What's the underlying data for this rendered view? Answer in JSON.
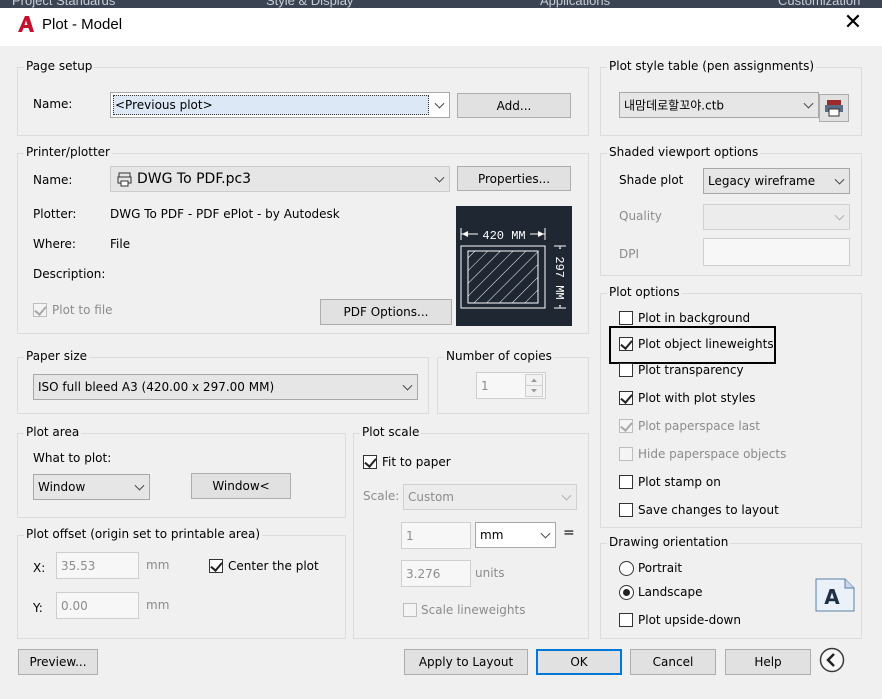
{
  "menubar": {
    "items": [
      "Project Standards",
      "Style & Display",
      "Applications",
      "Customization"
    ]
  },
  "window": {
    "title": "Plot - Model",
    "close_glyph": "✕"
  },
  "page_setup": {
    "group_label": "Page setup",
    "name_label": "Name:",
    "name_value": "<Previous plot>",
    "add_button": "Add..."
  },
  "printer": {
    "group_label": "Printer/plotter",
    "name_label": "Name:",
    "name_value": "DWG To PDF.pc3",
    "properties_button": "Properties...",
    "plotter_label": "Plotter:",
    "plotter_value": "DWG To PDF - PDF ePlot - by Autodesk",
    "where_label": "Where:",
    "where_value": "File",
    "description_label": "Description:",
    "plot_to_file_label": "Plot to file",
    "pdf_options_button": "PDF Options...",
    "preview": {
      "width_label": "420 MM",
      "height_label": "297 MM"
    }
  },
  "paper_size": {
    "group_label": "Paper size",
    "value": "ISO full bleed A3 (420.00 x 297.00 MM)"
  },
  "copies": {
    "group_label": "Number of copies",
    "value": "1"
  },
  "plot_area": {
    "group_label": "Plot area",
    "what_label": "What to plot:",
    "what_value": "Window",
    "window_button": "Window<"
  },
  "plot_offset": {
    "group_label": "Plot offset (origin set to printable area)",
    "x_label": "X:",
    "x_value": "35.53",
    "y_label": "Y:",
    "y_value": "0.00",
    "unit": "mm",
    "center_label": "Center the plot"
  },
  "plot_scale": {
    "group_label": "Plot scale",
    "fit_label": "Fit to paper",
    "scale_label": "Scale:",
    "scale_value": "Custom",
    "value1": "1",
    "unit_value": "mm",
    "equals": "=",
    "value2": "3.276",
    "units_label": "units",
    "lineweights_label": "Scale lineweights"
  },
  "plot_style": {
    "group_label": "Plot style table (pen assignments)",
    "value": "내맘데로할꼬야.ctb"
  },
  "shaded": {
    "group_label": "Shaded viewport options",
    "shade_label": "Shade plot",
    "shade_value": "Legacy wireframe",
    "quality_label": "Quality",
    "dpi_label": "DPI"
  },
  "plot_options": {
    "group_label": "Plot options",
    "items": [
      "Plot in background",
      "Plot object lineweights",
      "Plot transparency",
      "Plot with plot styles",
      "Plot paperspace last",
      "Hide paperspace objects",
      "Plot stamp on",
      "Save changes to layout"
    ]
  },
  "orientation": {
    "group_label": "Drawing orientation",
    "portrait": "Portrait",
    "landscape": "Landscape",
    "upside_down": "Plot upside-down",
    "icon_letter": "A"
  },
  "footer": {
    "preview": "Preview...",
    "apply": "Apply to Layout",
    "ok": "OK",
    "cancel": "Cancel",
    "help": "Help"
  }
}
